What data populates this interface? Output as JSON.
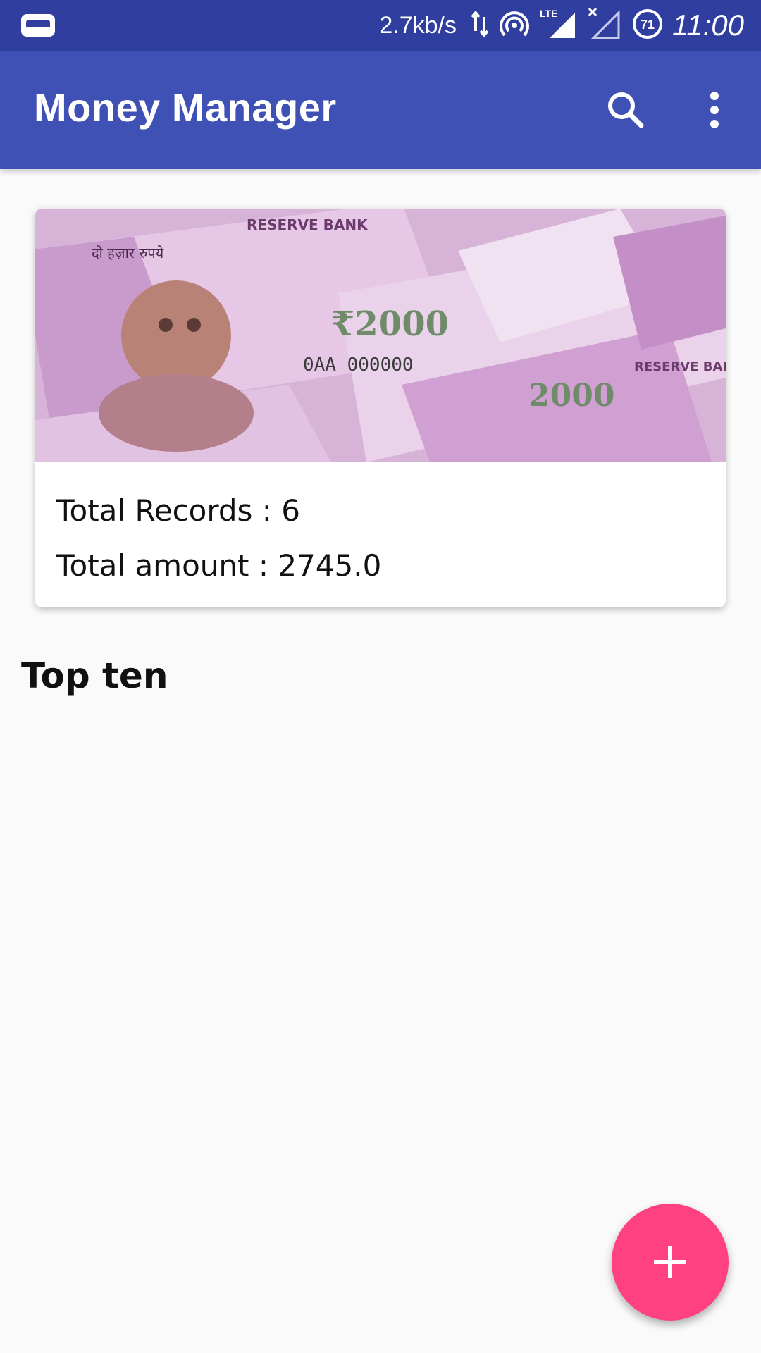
{
  "status_bar": {
    "net_speed": "2.7kb/s",
    "time": "11:00",
    "battery_level": "71",
    "icons": [
      "app-notification-icon",
      "data-transfer-icon",
      "hotspot-icon",
      "lte-signal-icon",
      "no-signal-icon",
      "battery-icon"
    ]
  },
  "app_bar": {
    "title": "Money Manager",
    "actions": [
      "search-icon",
      "more-vert-icon"
    ]
  },
  "summary_card": {
    "image": "currency-notes-banner",
    "total_records_text": "Total Records : 6",
    "total_amount_text": "Total amount : 2745.0"
  },
  "section": {
    "title": "Top ten"
  },
  "fab": {
    "icon": "add-icon"
  },
  "colors": {
    "status_bar": "#303f9f",
    "app_bar": "#3f51b5",
    "fab": "#ff4081",
    "background": "#fafafa"
  }
}
